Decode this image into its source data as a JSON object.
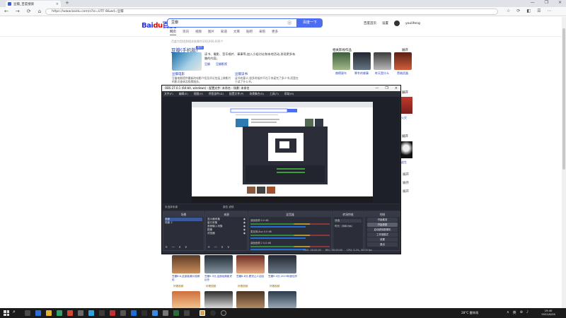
{
  "browser": {
    "tab_title": "豆瓣_百度搜索",
    "tab_close": "×",
    "newtab": "+",
    "url": "https://www.baidu.com/s?ie=UTF-8&wd=豆瓣",
    "nav": [
      "←",
      "→",
      "⟳",
      "⌂"
    ],
    "win_controls": [
      "—",
      "❐",
      "×"
    ],
    "icons": [
      "☆",
      "⟳",
      "◧",
      "☰",
      "⋯"
    ]
  },
  "baidu": {
    "logo_text": "Bai",
    "logo_red": "du",
    "logo_suffix": "百度",
    "query": "豆瓣",
    "cam_icon": "◎",
    "search_btn": "百度一下",
    "top_links": [
      "百度首页",
      "设置",
      "youlifeng"
    ],
    "tabs": [
      "网页",
      "资讯",
      "视频",
      "图片",
      "知道",
      "文库",
      "贴吧",
      "采购",
      "更多"
    ],
    "stats": "百度为您找到相关结果约100,000,000个",
    "result": {
      "title": "豆瓣(手机版)",
      "badge": "官方",
      "desc": "读书、電影、音乐唱片、事事等,加入小组讨论和本地活动,发现更多有趣的内容。",
      "links": [
        "豆瓣",
        "豆瓣影视"
      ],
      "sub_left": "豆瓣电影",
      "sub_left_desc": "豆瓣电影提供最新的电影介绍及评论包括上映影片的影讯查询及购票服务。",
      "sub_right": "豆瓣读书",
      "sub_right_desc": "读书的意义,很多时候并不在于你读完了多少书,而是在于读了什么书。"
    },
    "right": {
      "title": "相关影视作品",
      "more": "展开",
      "items": [
        "赫德观鸟",
        "寒冬的故事",
        "昨天是什么",
        "黑暗武器"
      ],
      "lbl2": "火灾",
      "lbl3": "逃生",
      "extra_more": [
        "展开",
        "展开",
        "展开",
        "展开",
        "展开"
      ]
    },
    "videos": [
      {
        "title": "豆瓣8.6,这部高清片段精彩",
        "src": "好看视频"
      },
      {
        "title": "豆瓣9.3分,这部经典影史巨作",
        "src": "好看视频"
      },
      {
        "title": "豆瓣8.8分,看完让人泪目",
        "src": "好看视频"
      },
      {
        "title": "豆瓣9.0分,2019年度佳作",
        "src": "好看视频"
      }
    ]
  },
  "obs": {
    "title": "OBS 27.0.1 (64-bit, windows) - 配置文件: 未命名 - 场景: 未命名",
    "win_controls": [
      "—",
      "❐",
      "×"
    ],
    "menu": [
      "文件(F)",
      "编辑(E)",
      "视图(V)",
      "停靠部件(D)",
      "配置文件(P)",
      "场景集合(S)",
      "工具(T)",
      "帮助(H)"
    ],
    "status_left": "未选择来源",
    "status_center": "属性  滤镜",
    "docks": {
      "scenes": {
        "title": "场景",
        "items": [
          "场景",
          "场景 2"
        ]
      },
      "sources": {
        "title": "来源",
        "items": [
          "显示器采集",
          "窗口采集",
          "音频输入采集",
          "图像",
          "浏览器"
        ]
      },
      "mixer": {
        "title": "混音器",
        "rows": [
          "桌面音频  0.0 dB",
          "麦克风/Aux  0.0 dB",
          "桌面音频 2  0.0 dB"
        ]
      },
      "transitions": {
        "title": "转场特效",
        "mode": "淡出",
        "duration_label": "时长",
        "duration": "300 ms"
      },
      "controls": {
        "title": "控制",
        "buttons": [
          "开始推流",
          "开始录制",
          "启动虚拟摄像机",
          "工作室模式",
          "设置",
          "退出"
        ]
      }
    },
    "status": [
      "LIVE: 00:00:00",
      "REC: 00:00:00",
      "CPU: 3.2%, 30.00 fps"
    ],
    "foot": [
      "+",
      "—",
      "∧",
      "∨"
    ]
  },
  "taskbar": {
    "weather": "28°C 雷阵雨",
    "tray": [
      "∧",
      "英",
      "⊕",
      "♪"
    ],
    "time": "19:40",
    "date": "2021/8/26",
    "search_icon": "⌕"
  }
}
